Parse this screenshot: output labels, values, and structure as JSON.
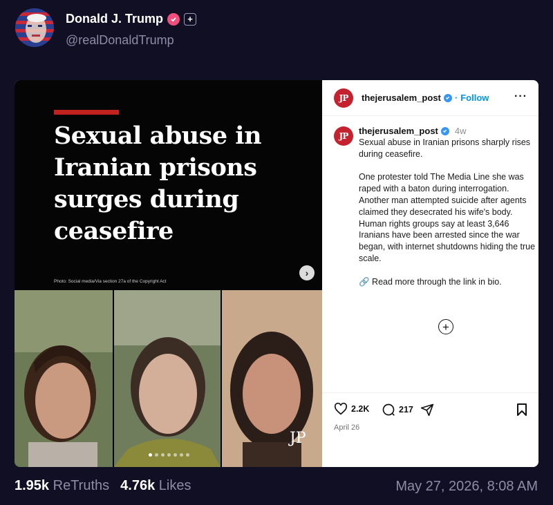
{
  "author": {
    "name": "Donald J. Trump",
    "handle": "@realDonaldTrump",
    "plus_badge": "+"
  },
  "media": {
    "headline": "Sexual abuse in Iranian prisons surges during ceasefire",
    "photo_credit": "Photo: Social media/Via section 27a of the Copyright Act",
    "watermark": "JP",
    "carousel": {
      "count": 7,
      "active": 1
    }
  },
  "post": {
    "account": "thejerusalem_post",
    "logo_text": "JP",
    "follow_label": "Follow",
    "age": "4w",
    "caption_paragraphs": [
      "Sexual abuse in Iranian prisons sharply rises during ceasefire.",
      "One protester told The Media Line she was raped with a baton during interrogation. Another man attempted suicide after agents claimed they desecrated his wife's body. Human rights groups say at least 3,646 Iranians have been arrested since the war began, with internet shutdowns hiding the true scale.",
      "🔗 Read more through the link in bio."
    ],
    "likes": "2.2K",
    "comments": "217",
    "date": "April 26"
  },
  "stats": {
    "retruths_count": "1.95k",
    "retruths_label": "ReTruths",
    "likes_count": "4.76k",
    "likes_label": "Likes",
    "timestamp": "May 27, 2026, 8:08 AM"
  },
  "colors": {
    "background": "#110f24",
    "verified_badge": "#f04f7c",
    "jp_red": "#c52230",
    "follow_blue": "#0095f6",
    "muted_text": "#8f8ba8"
  }
}
